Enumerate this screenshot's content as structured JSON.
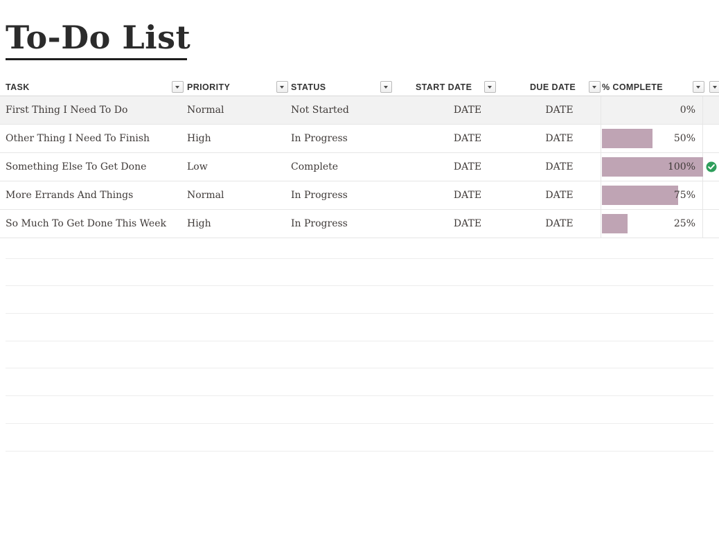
{
  "document": {
    "title": "To-Do List"
  },
  "table": {
    "columns": [
      {
        "key": "task",
        "label": "TASK"
      },
      {
        "key": "priority",
        "label": "PRIORITY"
      },
      {
        "key": "status",
        "label": "STATUS"
      },
      {
        "key": "start_date",
        "label": "START DATE"
      },
      {
        "key": "due_date",
        "label": "DUE DATE"
      },
      {
        "key": "percent",
        "label": "% COMPLETE"
      }
    ],
    "filter_button_icon": "chevron-down-icon",
    "filter_button_count": 7,
    "rows": [
      {
        "task": "First Thing I Need To Do",
        "priority": "Normal",
        "status": "Not Started",
        "start_date": "DATE",
        "due_date": "DATE",
        "percent_label": "0%",
        "percent_value": 0,
        "complete_check": false
      },
      {
        "task": "Other Thing I Need To Finish",
        "priority": "High",
        "status": "In Progress",
        "start_date": "DATE",
        "due_date": "DATE",
        "percent_label": "50%",
        "percent_value": 50,
        "complete_check": false
      },
      {
        "task": "Something Else To Get Done",
        "priority": "Low",
        "status": "Complete",
        "start_date": "DATE",
        "due_date": "DATE",
        "percent_label": "100%",
        "percent_value": 100,
        "complete_check": true
      },
      {
        "task": "More Errands And Things",
        "priority": "Normal",
        "status": "In Progress",
        "start_date": "DATE",
        "due_date": "DATE",
        "percent_label": "75%",
        "percent_value": 75,
        "complete_check": false
      },
      {
        "task": "So Much To Get Done This Week",
        "priority": "High",
        "status": "In Progress",
        "start_date": "DATE",
        "due_date": "DATE",
        "percent_label": "25%",
        "percent_value": 25,
        "complete_check": false
      }
    ],
    "empty_row_count": 8
  },
  "colors": {
    "progress_bar": "#bfa4b4",
    "complete_check": "#2e9e5b",
    "alt_row_background": "#f2f2f2",
    "rule": "#1d1d1d",
    "grid_line": "#ededed",
    "text": "#3f3a38"
  },
  "icons": {
    "complete_check": "check-circle-icon",
    "filter_caret": "chevron-down-icon"
  }
}
